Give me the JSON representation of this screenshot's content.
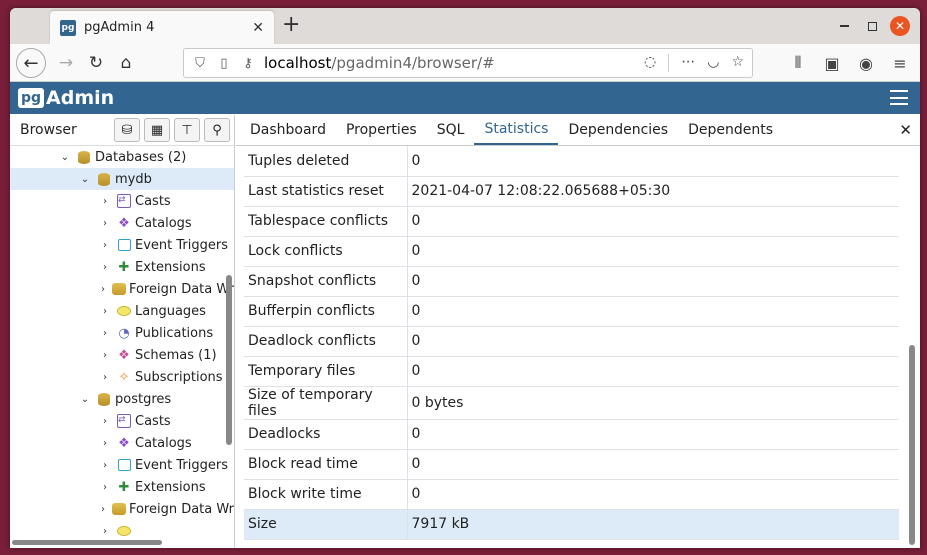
{
  "browser": {
    "tab_title": "pgAdmin 4",
    "favicon_text": "pg",
    "url_host": "localhost",
    "url_path": "/pgadmin4/browser/#",
    "win_close_glyph": "✕"
  },
  "app": {
    "logo_box": "pg",
    "logo_word": "Admin"
  },
  "left": {
    "title": "Browser",
    "tree": [
      {
        "label": "Databases (2)",
        "icon": "database-icon",
        "indent": 0,
        "caret": "⌄",
        "selected": false
      },
      {
        "label": "mydb",
        "icon": "database-icon",
        "indent": 1,
        "caret": "⌄",
        "selected": true
      },
      {
        "label": "Casts",
        "icon": "casts-icon",
        "indent": 2,
        "caret": "›",
        "selected": false
      },
      {
        "label": "Catalogs",
        "icon": "catalogs-icon",
        "indent": 2,
        "caret": "›",
        "selected": false
      },
      {
        "label": "Event Triggers",
        "icon": "event-triggers-icon",
        "indent": 2,
        "caret": "›",
        "selected": false
      },
      {
        "label": "Extensions",
        "icon": "extensions-icon",
        "indent": 2,
        "caret": "›",
        "selected": false
      },
      {
        "label": "Foreign Data Wr",
        "icon": "foreign-data-wrapper-icon",
        "indent": 2,
        "caret": "›",
        "selected": false
      },
      {
        "label": "Languages",
        "icon": "languages-icon",
        "indent": 2,
        "caret": "›",
        "selected": false
      },
      {
        "label": "Publications",
        "icon": "publications-icon",
        "indent": 2,
        "caret": "›",
        "selected": false
      },
      {
        "label": "Schemas (1)",
        "icon": "schemas-icon",
        "indent": 2,
        "caret": "›",
        "selected": false
      },
      {
        "label": "Subscriptions",
        "icon": "subscriptions-icon",
        "indent": 2,
        "caret": "›",
        "selected": false
      },
      {
        "label": "postgres",
        "icon": "database-icon",
        "indent": 1,
        "caret": "⌄",
        "selected": false
      },
      {
        "label": "Casts",
        "icon": "casts-icon",
        "indent": 2,
        "caret": "›",
        "selected": false
      },
      {
        "label": "Catalogs",
        "icon": "catalogs-icon",
        "indent": 2,
        "caret": "›",
        "selected": false
      },
      {
        "label": "Event Triggers",
        "icon": "event-triggers-icon",
        "indent": 2,
        "caret": "›",
        "selected": false
      },
      {
        "label": "Extensions",
        "icon": "extensions-icon",
        "indent": 2,
        "caret": "›",
        "selected": false
      },
      {
        "label": "Foreign Data Wr",
        "icon": "foreign-data-wrapper-icon",
        "indent": 2,
        "caret": "›",
        "selected": false
      },
      {
        "label": "",
        "icon": "languages-icon",
        "indent": 2,
        "caret": "›",
        "selected": false
      }
    ]
  },
  "tabs": [
    {
      "label": "Dashboard",
      "active": false
    },
    {
      "label": "Properties",
      "active": false
    },
    {
      "label": "SQL",
      "active": false
    },
    {
      "label": "Statistics",
      "active": true
    },
    {
      "label": "Dependencies",
      "active": false
    },
    {
      "label": "Dependents",
      "active": false
    }
  ],
  "stats": [
    {
      "key": "Tuples deleted",
      "value": "0"
    },
    {
      "key": "Last statistics reset",
      "value": "2021-04-07 12:08:22.065688+05:30"
    },
    {
      "key": "Tablespace conflicts",
      "value": "0"
    },
    {
      "key": "Lock conflicts",
      "value": "0"
    },
    {
      "key": "Snapshot conflicts",
      "value": "0"
    },
    {
      "key": "Bufferpin conflicts",
      "value": "0"
    },
    {
      "key": "Deadlock conflicts",
      "value": "0"
    },
    {
      "key": "Temporary files",
      "value": "0"
    },
    {
      "key": "Size of temporary files",
      "value": "0 bytes"
    },
    {
      "key": "Deadlocks",
      "value": "0"
    },
    {
      "key": "Block read time",
      "value": "0"
    },
    {
      "key": "Block write time",
      "value": "0"
    },
    {
      "key": "Size",
      "value": "7917 kB",
      "highlight": true
    }
  ],
  "colors": {
    "pg_blue": "#326690",
    "selected_row": "#dcebf7",
    "ubuntu_orange": "#e95420"
  }
}
